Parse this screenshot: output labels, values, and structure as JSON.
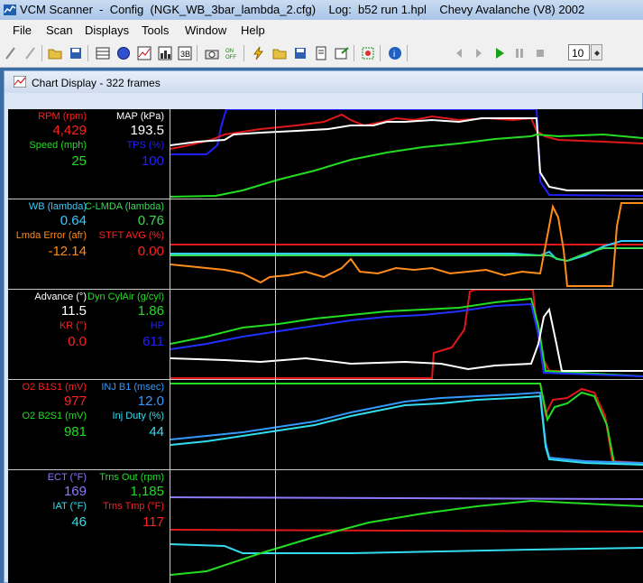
{
  "window": {
    "title": "VCM Scanner  -  Config  (NGK_WB_3bar_lambda_2.cfg)    Log:  b52 run 1.hpl    Chevy Avalanche (V8) 2002"
  },
  "menu": [
    "File",
    "Scan",
    "Displays",
    "Tools",
    "Window",
    "Help"
  ],
  "toolbar": {
    "frames_value": "10"
  },
  "chart_window": {
    "title": "Chart Display  -  322 frames"
  },
  "panels": [
    {
      "top_left": {
        "label": "RPM (rpm)",
        "value": "4,429",
        "color": "#ff2020"
      },
      "top_right": {
        "label": "MAP (kPa)",
        "value": "193.5",
        "color": "#ffffff"
      },
      "bottom_left": {
        "label": "Speed (mph)",
        "value": "25",
        "color": "#22dd22"
      },
      "bottom_right": {
        "label": "TPS (%)",
        "value": "100",
        "color": "#2020ff"
      }
    },
    {
      "top_left": {
        "label": "WB (lambda)",
        "value": "0.64",
        "color": "#33ccff"
      },
      "top_right": {
        "label": "C-LMDA (lambda)",
        "value": "0.76",
        "color": "#33dd55"
      },
      "bottom_left": {
        "label": "Lmda Error (afr)",
        "value": "-12.14",
        "color": "#ff8c1a"
      },
      "bottom_right": {
        "label": "STFT AVG (%)",
        "value": "0.00",
        "color": "#ff2020"
      }
    },
    {
      "top_left": {
        "label": "Advance (°)",
        "value": "11.5",
        "color": "#ffffff"
      },
      "top_right": {
        "label": "Dyn CylAir (g/cyl)",
        "value": "1.86",
        "color": "#22dd22"
      },
      "bottom_left": {
        "label": "KR (°)",
        "value": "0.0",
        "color": "#ff2020"
      },
      "bottom_right": {
        "label": "HP",
        "value": "611",
        "color": "#2020ff"
      }
    },
    {
      "top_left": {
        "label": "O2 B1S1 (mV)",
        "value": "977",
        "color": "#ff2020"
      },
      "top_right": {
        "label": "INJ B1 (msec)",
        "value": "12.0",
        "color": "#3399ff"
      },
      "bottom_left": {
        "label": "O2 B2S1 (mV)",
        "value": "981",
        "color": "#22dd22"
      },
      "bottom_right": {
        "label": "Inj Duty (%)",
        "value": "44",
        "color": "#33ddee"
      }
    },
    {
      "top_left": {
        "label": "ECT (°F)",
        "value": "169",
        "color": "#8a7aff"
      },
      "top_right": {
        "label": "Trns Out (rpm)",
        "value": "1,185",
        "color": "#22dd22"
      },
      "bottom_left": {
        "label": "IAT (°F)",
        "value": "46",
        "color": "#33ddee"
      },
      "bottom_right": {
        "label": "Trns Tmp (°F)",
        "value": "117",
        "color": "#ff2020"
      }
    }
  ]
}
